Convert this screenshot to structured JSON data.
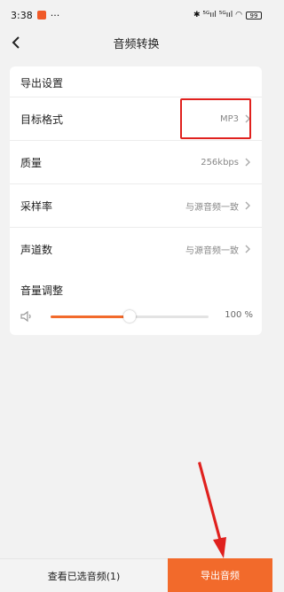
{
  "status_bar": {
    "time": "3:38",
    "ellipsis": "···",
    "right_icons": "✱ ⁵ᴳııl ⁵ᴳııl ◠",
    "battery": "99"
  },
  "header": {
    "title": "音频转换"
  },
  "settings": {
    "section_title": "导出设置",
    "rows": [
      {
        "label": "目标格式",
        "value": "MP3"
      },
      {
        "label": "质量",
        "value": "256kbps"
      },
      {
        "label": "采样率",
        "value": "与源音频一致"
      },
      {
        "label": "声道数",
        "value": "与源音频一致"
      }
    ],
    "volume": {
      "label": "音量调整",
      "value_text": "100 %",
      "slider_fraction": 0.5
    }
  },
  "bottom": {
    "view_selected_label": "查看已选音频(1)",
    "export_label": "导出音频"
  },
  "colors": {
    "accent": "#f26a2b",
    "highlight": "#e0211e"
  },
  "icons": [
    "back-arrow-icon",
    "chevron-right-icon",
    "speaker-icon",
    "annotation-arrow"
  ]
}
